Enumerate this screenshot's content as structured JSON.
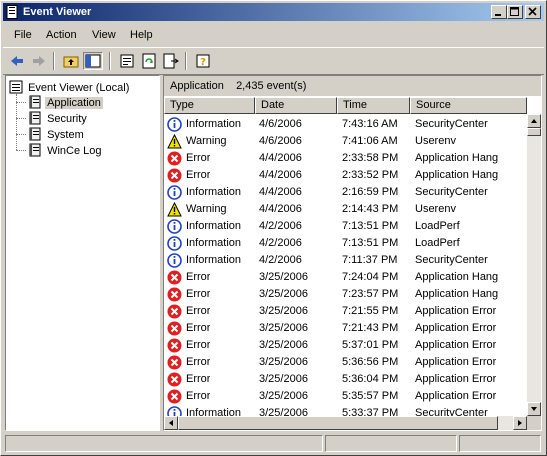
{
  "window": {
    "title": "Event Viewer"
  },
  "menu": [
    "File",
    "Action",
    "View",
    "Help"
  ],
  "toolbar": {
    "icons": [
      "back-arrow-icon",
      "forward-arrow-icon",
      "up-folder-icon",
      "show-hide-tree-icon",
      "properties-icon",
      "refresh-icon",
      "export-list-icon",
      "help-icon"
    ]
  },
  "tree": {
    "root": "Event Viewer (Local)",
    "children": [
      "Application",
      "Security",
      "System",
      "WinCe Log"
    ],
    "selected": "Application"
  },
  "panel": {
    "name": "Application",
    "count": "2,435 event(s)"
  },
  "columns": [
    "Type",
    "Date",
    "Time",
    "Source"
  ],
  "rows": [
    {
      "type": "Information",
      "date": "4/6/2006",
      "time": "7:43:16 AM",
      "source": "SecurityCenter"
    },
    {
      "type": "Warning",
      "date": "4/6/2006",
      "time": "7:41:06 AM",
      "source": "Userenv"
    },
    {
      "type": "Error",
      "date": "4/4/2006",
      "time": "2:33:58 PM",
      "source": "Application Hang"
    },
    {
      "type": "Error",
      "date": "4/4/2006",
      "time": "2:33:52 PM",
      "source": "Application Hang"
    },
    {
      "type": "Information",
      "date": "4/4/2006",
      "time": "2:16:59 PM",
      "source": "SecurityCenter"
    },
    {
      "type": "Warning",
      "date": "4/4/2006",
      "time": "2:14:43 PM",
      "source": "Userenv"
    },
    {
      "type": "Information",
      "date": "4/2/2006",
      "time": "7:13:51 PM",
      "source": "LoadPerf"
    },
    {
      "type": "Information",
      "date": "4/2/2006",
      "time": "7:13:51 PM",
      "source": "LoadPerf"
    },
    {
      "type": "Information",
      "date": "4/2/2006",
      "time": "7:11:37 PM",
      "source": "SecurityCenter"
    },
    {
      "type": "Error",
      "date": "3/25/2006",
      "time": "7:24:04 PM",
      "source": "Application Hang"
    },
    {
      "type": "Error",
      "date": "3/25/2006",
      "time": "7:23:57 PM",
      "source": "Application Hang"
    },
    {
      "type": "Error",
      "date": "3/25/2006",
      "time": "7:21:55 PM",
      "source": "Application Error"
    },
    {
      "type": "Error",
      "date": "3/25/2006",
      "time": "7:21:43 PM",
      "source": "Application Error"
    },
    {
      "type": "Error",
      "date": "3/25/2006",
      "time": "5:37:01 PM",
      "source": "Application Error"
    },
    {
      "type": "Error",
      "date": "3/25/2006",
      "time": "5:36:56 PM",
      "source": "Application Error"
    },
    {
      "type": "Error",
      "date": "3/25/2006",
      "time": "5:36:04 PM",
      "source": "Application Error"
    },
    {
      "type": "Error",
      "date": "3/25/2006",
      "time": "5:35:57 PM",
      "source": "Application Error"
    },
    {
      "type": "Information",
      "date": "3/25/2006",
      "time": "5:33:37 PM",
      "source": "SecurityCenter"
    }
  ],
  "colors": {
    "titlebar_start": "#0a246a",
    "titlebar_end": "#a6caf0",
    "error": "#e02020",
    "info": "#2040c0",
    "warning": "#f0e000"
  }
}
